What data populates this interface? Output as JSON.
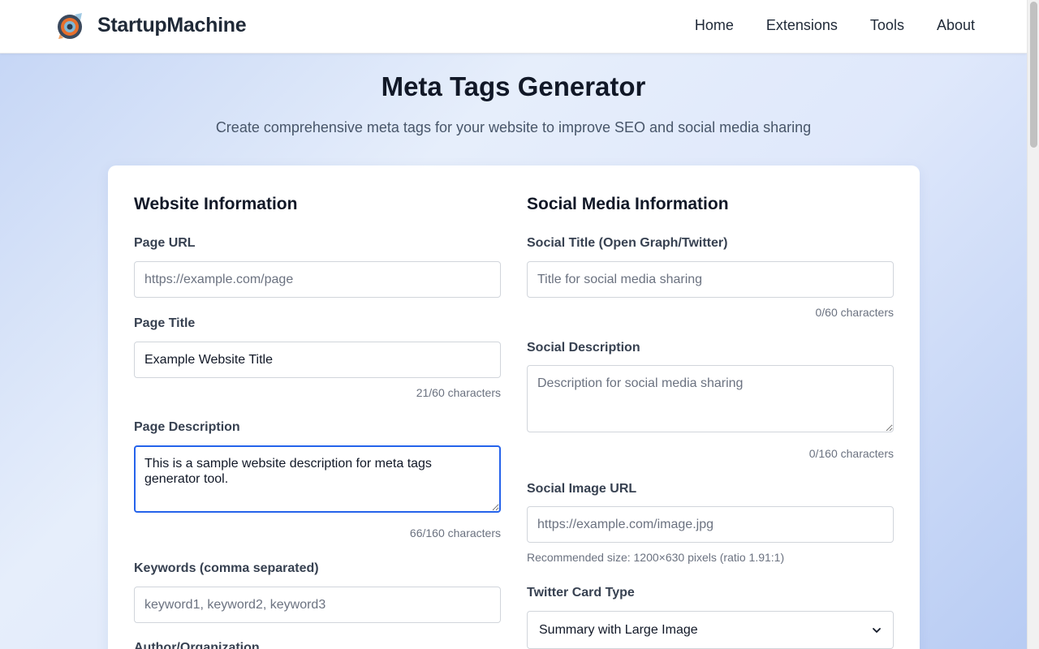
{
  "header": {
    "brand": "StartupMachine",
    "nav": [
      "Home",
      "Extensions",
      "Tools",
      "About"
    ]
  },
  "hero": {
    "title": "Meta Tags Generator",
    "subtitle": "Create comprehensive meta tags for your website to improve SEO and social media sharing"
  },
  "website_info": {
    "section_title": "Website Information",
    "page_url": {
      "label": "Page URL",
      "value": "",
      "placeholder": "https://example.com/page"
    },
    "page_title": {
      "label": "Page Title",
      "value": "Example Website Title",
      "placeholder": "",
      "counter": "21/60 characters"
    },
    "page_description": {
      "label": "Page Description",
      "value": "This is a sample website description for meta tags generator tool.",
      "placeholder": "",
      "counter": "66/160 characters"
    },
    "keywords": {
      "label": "Keywords (comma separated)",
      "value": "",
      "placeholder": "keyword1, keyword2, keyword3"
    },
    "author": {
      "label": "Author/Organization"
    }
  },
  "social_info": {
    "section_title": "Social Media Information",
    "social_title": {
      "label": "Social Title (Open Graph/Twitter)",
      "value": "",
      "placeholder": "Title for social media sharing",
      "counter": "0/60 characters"
    },
    "social_description": {
      "label": "Social Description",
      "value": "",
      "placeholder": "Description for social media sharing",
      "counter": "0/160 characters"
    },
    "social_image": {
      "label": "Social Image URL",
      "value": "",
      "placeholder": "https://example.com/image.jpg",
      "hint": "Recommended size: 1200×630 pixels (ratio 1.91:1)"
    },
    "twitter_card": {
      "label": "Twitter Card Type",
      "selected": "Summary with Large Image"
    }
  },
  "colors": {
    "accent": "#2563eb",
    "text": "#111827",
    "muted": "#6b7280"
  }
}
